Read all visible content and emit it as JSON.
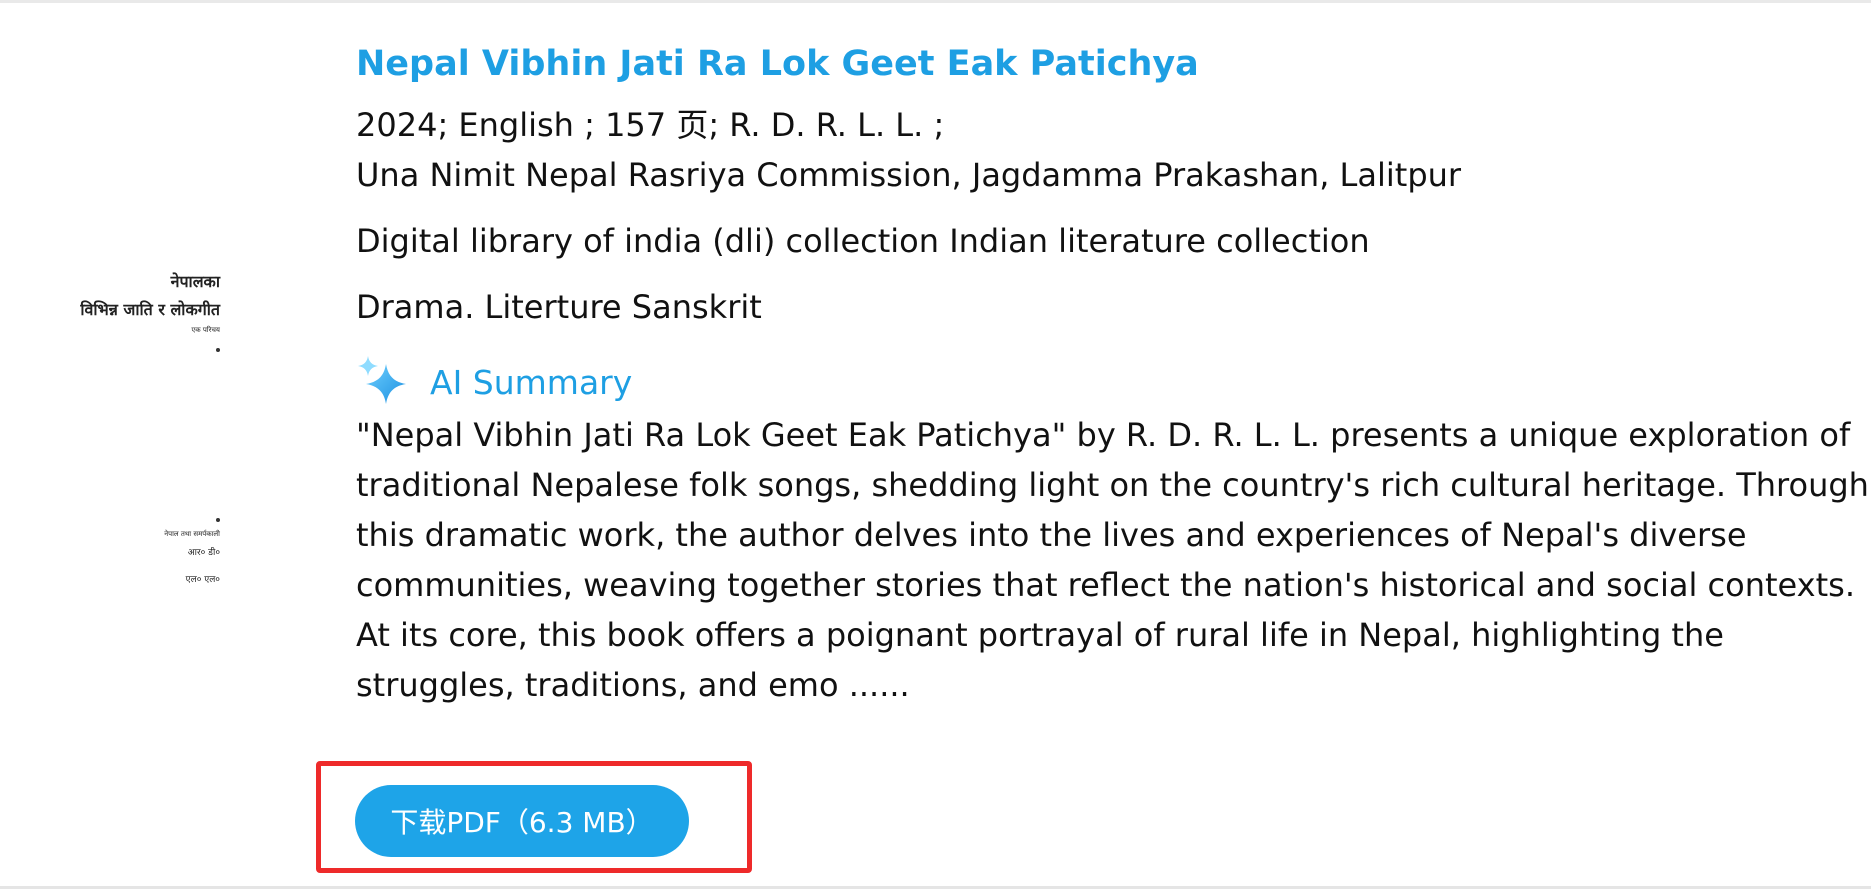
{
  "book": {
    "title": "Nepal Vibhin Jati Ra Lok Geet Eak Patichya",
    "meta_line1": "2024; English ; 157 页; R. D. R. L. L. ;",
    "meta_line2": "Una Nimit Nepal Rasriya Commission, Jagdamma Prakashan, Lalitpur",
    "collection": "Digital library of india (dli) collection Indian literature collection",
    "subjects": "Drama. Literture Sanskrit"
  },
  "cover": {
    "line1": "नेपालका",
    "line2": "विभिन्न जाति र लोकगीत",
    "line3": "एक परिचय",
    "line4": "नेपाल तथा समर्पकाली",
    "line5": "आर० डी०",
    "line6": "एल० एल०"
  },
  "ai_summary": {
    "label": "AI Summary",
    "icon": "sparkle-icon",
    "lines": [
      "\"Nepal Vibhin Jati Ra Lok Geet Eak Patichya\" by R. D. R. L. L. presents a unique exploration of",
      "traditional Nepalese folk songs, shedding light on the country's rich cultural heritage. Through",
      "this dramatic work, the author delves into the lives and experiences of Nepal's diverse",
      "communities, weaving together stories that reflect the nation's historical and social contexts.",
      "At its core, this book offers a poignant portrayal of rural life in Nepal, highlighting the",
      "struggles, traditions, and emo ......"
    ]
  },
  "download": {
    "label": "下载PDF（6.3 MB）"
  },
  "colors": {
    "accent": "#1e9fe3",
    "button": "#1ea4e8",
    "highlight": "#ee2a2a"
  }
}
